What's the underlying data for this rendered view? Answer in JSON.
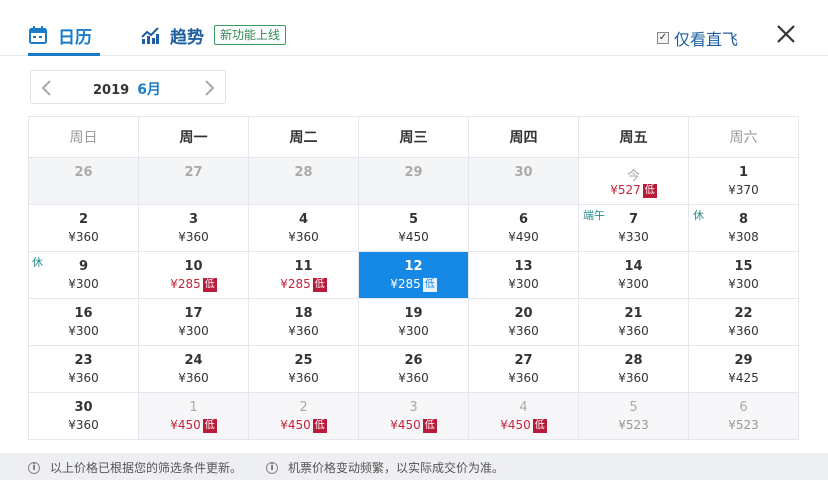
{
  "header": {
    "tab_calendar": "日历",
    "tab_trend": "趋势",
    "new_feature_badge": "新功能上线",
    "direct_only_label": "仅看直飞",
    "direct_only_checked": true,
    "accent_color": "#1a7cc9"
  },
  "month_selector": {
    "year": "2019",
    "month": "6月"
  },
  "weekdays": [
    "周日",
    "周一",
    "周二",
    "周三",
    "周四",
    "周五",
    "周六"
  ],
  "low_badge": "低",
  "weeks": [
    [
      {
        "day": "26",
        "price": "",
        "state": "past"
      },
      {
        "day": "27",
        "price": "",
        "state": "past"
      },
      {
        "day": "28",
        "price": "",
        "state": "past"
      },
      {
        "day": "29",
        "price": "",
        "state": "past"
      },
      {
        "day": "30",
        "price": "",
        "state": "past"
      },
      {
        "day": "今",
        "price": "¥527",
        "state": "today",
        "low": true
      },
      {
        "day": "1",
        "price": "¥370",
        "state": "normal"
      }
    ],
    [
      {
        "day": "2",
        "price": "¥360",
        "state": "normal"
      },
      {
        "day": "3",
        "price": "¥360",
        "state": "normal"
      },
      {
        "day": "4",
        "price": "¥360",
        "state": "normal"
      },
      {
        "day": "5",
        "price": "¥450",
        "state": "normal"
      },
      {
        "day": "6",
        "price": "¥490",
        "state": "normal"
      },
      {
        "day": "7",
        "price": "¥330",
        "state": "normal",
        "holiday": "端午"
      },
      {
        "day": "8",
        "price": "¥308",
        "state": "normal",
        "holiday": "休"
      }
    ],
    [
      {
        "day": "9",
        "price": "¥300",
        "state": "normal",
        "holiday": "休"
      },
      {
        "day": "10",
        "price": "¥285",
        "state": "normal",
        "low": true
      },
      {
        "day": "11",
        "price": "¥285",
        "state": "normal",
        "low": true
      },
      {
        "day": "12",
        "price": "¥285",
        "state": "selected",
        "low": true
      },
      {
        "day": "13",
        "price": "¥300",
        "state": "normal"
      },
      {
        "day": "14",
        "price": "¥300",
        "state": "normal"
      },
      {
        "day": "15",
        "price": "¥300",
        "state": "normal"
      }
    ],
    [
      {
        "day": "16",
        "price": "¥300",
        "state": "normal"
      },
      {
        "day": "17",
        "price": "¥300",
        "state": "normal"
      },
      {
        "day": "18",
        "price": "¥360",
        "state": "normal"
      },
      {
        "day": "19",
        "price": "¥300",
        "state": "normal"
      },
      {
        "day": "20",
        "price": "¥360",
        "state": "normal"
      },
      {
        "day": "21",
        "price": "¥360",
        "state": "normal"
      },
      {
        "day": "22",
        "price": "¥360",
        "state": "normal"
      }
    ],
    [
      {
        "day": "23",
        "price": "¥360",
        "state": "normal"
      },
      {
        "day": "24",
        "price": "¥360",
        "state": "normal"
      },
      {
        "day": "25",
        "price": "¥360",
        "state": "normal"
      },
      {
        "day": "26",
        "price": "¥360",
        "state": "normal"
      },
      {
        "day": "27",
        "price": "¥360",
        "state": "normal"
      },
      {
        "day": "28",
        "price": "¥360",
        "state": "normal"
      },
      {
        "day": "29",
        "price": "¥425",
        "state": "normal"
      }
    ],
    [
      {
        "day": "30",
        "price": "¥360",
        "state": "normal"
      },
      {
        "day": "1",
        "price": "¥450",
        "state": "other",
        "low": true
      },
      {
        "day": "2",
        "price": "¥450",
        "state": "other",
        "low": true
      },
      {
        "day": "3",
        "price": "¥450",
        "state": "other",
        "low": true
      },
      {
        "day": "4",
        "price": "¥450",
        "state": "other",
        "low": true
      },
      {
        "day": "5",
        "price": "¥523",
        "state": "other"
      },
      {
        "day": "6",
        "price": "¥523",
        "state": "other"
      }
    ]
  ],
  "footer": {
    "note1": "以上价格已根据您的筛选条件更新。",
    "note2": "机票价格变动频繁，以实际成交价为准。"
  }
}
